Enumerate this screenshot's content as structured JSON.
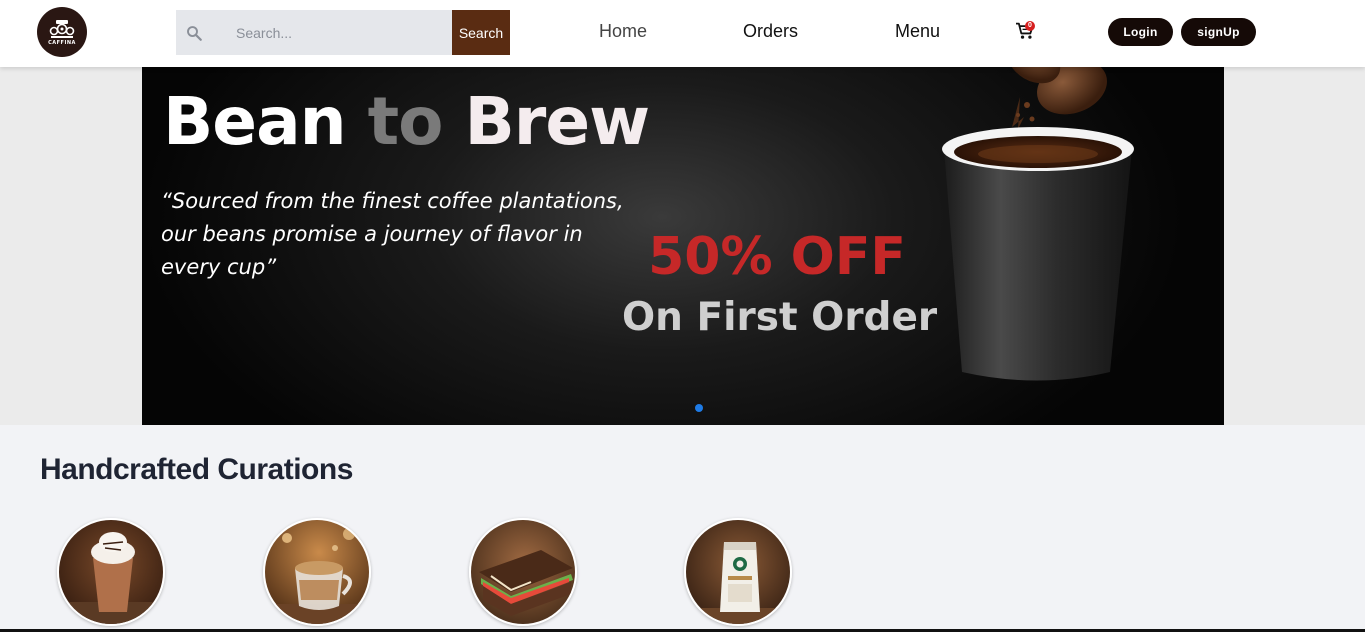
{
  "header": {
    "logo_text": "CAFFINA",
    "search": {
      "placeholder": "Search...",
      "button_label": "Search"
    },
    "nav": [
      {
        "label": "Home"
      },
      {
        "label": "Orders"
      },
      {
        "label": "Menu"
      }
    ],
    "cart_count": "0",
    "login_label": "Login",
    "signup_label": "signUp"
  },
  "hero": {
    "title_part1": "Bean",
    "title_part2": "to",
    "title_part3": "Brew",
    "quote": "“Sourced from the finest coffee plantations, our beans promise a journey of flavor in every cup”",
    "offer": "50% OFF",
    "offer_sub": "On First Order",
    "active_slide": 1
  },
  "curations": {
    "title": "Handcrafted Curations",
    "items": [
      {
        "icon": "frappuccino-image"
      },
      {
        "icon": "latte-image"
      },
      {
        "icon": "sandwich-image"
      },
      {
        "icon": "coffee-beans-bag-image"
      }
    ]
  },
  "colors": {
    "search_button": "#5a2c12",
    "offer": "#c62828",
    "slide_dot": "#1e7be6",
    "pill_buttons": "#150a07"
  }
}
